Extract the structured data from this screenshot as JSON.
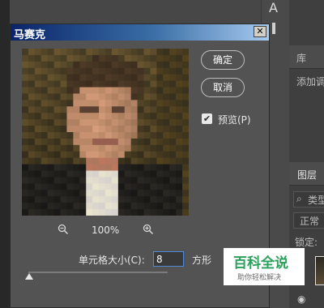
{
  "dialog": {
    "title": "马赛克",
    "close_glyph": "✕",
    "ok_label": "确定",
    "cancel_label": "取消",
    "preview_label": "预览(P)",
    "preview_checked": true,
    "zoom_level": "100%",
    "cell_size_label": "单元格大小(C):",
    "cell_size_value": "8",
    "unit_label": "方形",
    "slider_value": 8
  },
  "background": {
    "tool_letter": "A",
    "panel_tab_library": "库",
    "panel_hint": "添加调",
    "panel_tab_layers": "图层",
    "layers_search": "类型",
    "blend_mode": "正常",
    "lock_label": "锁定:"
  },
  "watermark": {
    "main": "百科全说",
    "sub": "助你轻松解决"
  },
  "colors": {
    "panel_bg": "#535353",
    "title_bar_start": "#0a246a",
    "title_bar_end": "#a6caf0",
    "watermark_green": "#2aa15b",
    "input_focus": "#4f8bd6"
  },
  "icons": {
    "zoom_out": "zoom-out-icon",
    "zoom_in": "zoom-in-icon",
    "checkbox": "checkmark-icon",
    "close": "close-icon",
    "eye": "eye-icon",
    "search": "search-icon"
  }
}
